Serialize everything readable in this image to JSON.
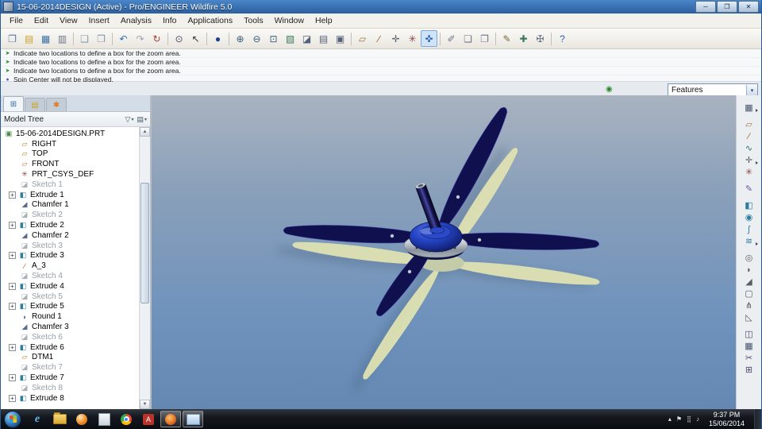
{
  "window": {
    "title": "15-06-2014DESIGN (Active) - Pro/ENGINEER Wildfire 5.0",
    "controls": [
      {
        "name": "minimize-button",
        "glyph": "─"
      },
      {
        "name": "maximize-button",
        "glyph": "❐"
      },
      {
        "name": "close-button",
        "glyph": "✕"
      }
    ]
  },
  "menu": [
    "File",
    "Edit",
    "View",
    "Insert",
    "Analysis",
    "Info",
    "Applications",
    "Tools",
    "Window",
    "Help"
  ],
  "toolbar": {
    "items": [
      {
        "name": "new-file-icon",
        "glyph": "❐",
        "color": "#5b7aa6"
      },
      {
        "name": "open-file-icon",
        "glyph": "▤",
        "color": "#c9a227"
      },
      {
        "name": "save-icon",
        "glyph": "▦",
        "color": "#3a6ea5"
      },
      {
        "name": "print-icon",
        "glyph": "▥",
        "color": "#6a7686"
      },
      {
        "sep": true
      },
      {
        "name": "copy-icon",
        "glyph": "❑",
        "color": "#8a96a6"
      },
      {
        "name": "paste-icon",
        "glyph": "❒",
        "color": "#8a96a6"
      },
      {
        "sep": true
      },
      {
        "name": "undo-icon",
        "glyph": "↶",
        "color": "#2f6fae"
      },
      {
        "name": "redo-icon",
        "glyph": "↷",
        "color": "#9aa6b4"
      },
      {
        "name": "regenerate-icon",
        "glyph": "↻",
        "color": "#b03a3a"
      },
      {
        "sep": true
      },
      {
        "name": "search-icon",
        "glyph": "⊙",
        "color": "#44506a"
      },
      {
        "name": "select-arrow-icon",
        "glyph": "↖",
        "color": "#333333"
      },
      {
        "sep": true
      },
      {
        "name": "shaded-display-icon",
        "glyph": "●",
        "color": "#1f3f8f"
      },
      {
        "sep": true
      },
      {
        "name": "zoom-in-icon",
        "glyph": "⊕",
        "color": "#3a5a7a"
      },
      {
        "name": "zoom-out-icon",
        "glyph": "⊖",
        "color": "#3a5a7a"
      },
      {
        "name": "refit-icon",
        "glyph": "⊡",
        "color": "#3a5a7a"
      },
      {
        "name": "repaint-icon",
        "glyph": "▧",
        "color": "#3a7a5a"
      },
      {
        "name": "saved-views-icon",
        "glyph": "◪",
        "color": "#55607a"
      },
      {
        "name": "layers-icon",
        "glyph": "▤",
        "color": "#55607a"
      },
      {
        "name": "view-manager-icon",
        "glyph": "▣",
        "color": "#55607a"
      },
      {
        "sep": true
      },
      {
        "name": "datum-planes-toggle",
        "glyph": "▱",
        "color": "#a07840"
      },
      {
        "name": "datum-axes-toggle",
        "glyph": "∕",
        "color": "#8b5a2b"
      },
      {
        "name": "datum-points-toggle",
        "glyph": "✛",
        "color": "#556066"
      },
      {
        "name": "csys-display-toggle",
        "glyph": "✳",
        "color": "#8b4444"
      },
      {
        "name": "spin-center-toggle",
        "glyph": "✜",
        "color": "#2f5faf",
        "pressed": true
      },
      {
        "sep": true
      },
      {
        "name": "annotation-icon",
        "glyph": "✐",
        "color": "#6a7686"
      },
      {
        "name": "model-windows-icon",
        "glyph": "❏",
        "color": "#6a7686"
      },
      {
        "name": "activate-window-icon",
        "glyph": "❐",
        "color": "#6a7686"
      },
      {
        "sep": true
      },
      {
        "name": "sketcher-display-icon",
        "glyph": "✎",
        "color": "#7a6a3a"
      },
      {
        "name": "analysis-measure-icon",
        "glyph": "✚",
        "color": "#3a7a5a"
      },
      {
        "name": "utilities-icon",
        "glyph": "✠",
        "color": "#6a7686"
      },
      {
        "sep": true
      },
      {
        "name": "context-help-icon",
        "glyph": "?",
        "color": "#2f5faf"
      }
    ]
  },
  "messages": [
    {
      "icon": "prompt-arrow-icon",
      "glyph": "➤",
      "color": "#1e8a1e",
      "text": "Indicate two locations to define a box for the zoom area."
    },
    {
      "icon": "prompt-arrow-icon",
      "glyph": "➤",
      "color": "#1e8a1e",
      "text": "Indicate two locations to define a box for the zoom area."
    },
    {
      "icon": "prompt-arrow-icon",
      "glyph": "➤",
      "color": "#1e8a1e",
      "text": "Indicate two locations to define a box for the zoom area."
    },
    {
      "icon": "info-dot-icon",
      "glyph": "●",
      "color": "#5a5ad6",
      "text": "Spin Center will not be displayed."
    }
  ],
  "subbar": {
    "status_icon": {
      "glyph": "◉",
      "color": "#2a8a2a"
    },
    "features_dropdown": {
      "value": "Features"
    }
  },
  "panel": {
    "tabs": [
      {
        "name": "tab-model-tree",
        "glyph": "⊞",
        "color": "#3a6ea5"
      },
      {
        "name": "tab-folder-browser",
        "glyph": "▤",
        "color": "#c9a227"
      },
      {
        "name": "tab-favorites",
        "glyph": "✱",
        "color": "#e07b20"
      }
    ],
    "header": {
      "title": "Model Tree"
    },
    "header_buttons": [
      {
        "name": "tree-filter-button",
        "glyph": "▽"
      },
      {
        "name": "tree-settings-button",
        "glyph": "▤"
      }
    ]
  },
  "model_tree": {
    "icon_defs": {
      "part": {
        "glyph": "▣",
        "color": "#4a8a4a"
      },
      "plane": {
        "glyph": "▱",
        "color": "#b08030"
      },
      "csys": {
        "glyph": "✳",
        "color": "#8b4444"
      },
      "sketch": {
        "glyph": "◪",
        "color": "#98a0a8"
      },
      "extrude": {
        "glyph": "◧",
        "color": "#2e7d9e"
      },
      "chamfer": {
        "glyph": "◢",
        "color": "#5a6a8a"
      },
      "round": {
        "glyph": "◗",
        "color": "#5a6a8a"
      },
      "axis": {
        "glyph": "∕",
        "color": "#8b5a2b"
      }
    },
    "items": [
      {
        "label": "15-06-2014DESIGN.PRT",
        "icon": "part",
        "root": true
      },
      {
        "label": "RIGHT",
        "icon": "plane"
      },
      {
        "label": "TOP",
        "icon": "plane"
      },
      {
        "label": "FRONT",
        "icon": "plane"
      },
      {
        "label": "PRT_CSYS_DEF",
        "icon": "csys"
      },
      {
        "label": "Sketch 1",
        "icon": "sketch",
        "disabled": true
      },
      {
        "label": "Extrude 1",
        "icon": "extrude",
        "expand": true
      },
      {
        "label": "Chamfer 1",
        "icon": "chamfer"
      },
      {
        "label": "Sketch 2",
        "icon": "sketch",
        "disabled": true
      },
      {
        "label": "Extrude 2",
        "icon": "extrude",
        "expand": true
      },
      {
        "label": "Chamfer 2",
        "icon": "chamfer"
      },
      {
        "label": "Sketch 3",
        "icon": "sketch",
        "disabled": true
      },
      {
        "label": "Extrude 3",
        "icon": "extrude",
        "expand": true
      },
      {
        "label": "A_3",
        "icon": "axis"
      },
      {
        "label": "Sketch 4",
        "icon": "sketch",
        "disabled": true
      },
      {
        "label": "Extrude 4",
        "icon": "extrude",
        "expand": true
      },
      {
        "label": "Sketch 5",
        "icon": "sketch",
        "disabled": true
      },
      {
        "label": "Extrude 5",
        "icon": "extrude",
        "expand": true
      },
      {
        "label": "Round 1",
        "icon": "round"
      },
      {
        "label": "Chamfer 3",
        "icon": "chamfer"
      },
      {
        "label": "Sketch 6",
        "icon": "sketch",
        "disabled": true
      },
      {
        "label": "Extrude 6",
        "icon": "extrude",
        "expand": true
      },
      {
        "label": "DTM1",
        "icon": "plane"
      },
      {
        "label": "Sketch 7",
        "icon": "sketch",
        "disabled": true
      },
      {
        "label": "Extrude 7",
        "icon": "extrude",
        "expand": true
      },
      {
        "label": "Sketch 8",
        "icon": "sketch",
        "disabled": true
      },
      {
        "label": "Extrude 8",
        "icon": "extrude",
        "expand": true
      }
    ]
  },
  "viewport": {
    "model": {
      "blade_color": "#10104e",
      "hub_color": "#2a4ac8",
      "shadow_color": "#dfe2b2",
      "ring_color": "#b8bfca"
    }
  },
  "right_toolbar": {
    "items": [
      {
        "name": "saved-view-list-icon",
        "glyph": "▦",
        "color": "#44506a",
        "flyout": true
      },
      {
        "gap": true
      },
      {
        "name": "datum-plane-tool",
        "glyph": "▱",
        "color": "#a07840"
      },
      {
        "name": "datum-axis-tool",
        "glyph": "∕",
        "color": "#8b5a2b"
      },
      {
        "name": "datum-curve-tool",
        "glyph": "∿",
        "color": "#2f6f6f"
      },
      {
        "name": "datum-point-tool",
        "glyph": "✛",
        "color": "#556066",
        "flyout": true
      },
      {
        "name": "datum-csys-tool",
        "glyph": "✳",
        "color": "#8b4444"
      },
      {
        "gap": true
      },
      {
        "name": "sketch-tool",
        "glyph": "✎",
        "color": "#6a5a9e"
      },
      {
        "gap": true
      },
      {
        "name": "extrude-tool",
        "glyph": "◧",
        "color": "#2e7d9e"
      },
      {
        "name": "revolve-tool",
        "glyph": "◉",
        "color": "#2e7d9e"
      },
      {
        "name": "sweep-tool",
        "glyph": "∫",
        "color": "#2e7d9e"
      },
      {
        "name": "blend-tool",
        "glyph": "≋",
        "color": "#2e7d9e",
        "flyout": true
      },
      {
        "gap": true
      },
      {
        "name": "hole-tool",
        "glyph": "◎",
        "color": "#556066"
      },
      {
        "name": "round-tool",
        "glyph": "◗",
        "color": "#556066"
      },
      {
        "name": "chamfer-tool",
        "glyph": "◢",
        "color": "#556066"
      },
      {
        "name": "shell-tool",
        "glyph": "▢",
        "color": "#556066"
      },
      {
        "name": "rib-tool",
        "glyph": "⋔",
        "color": "#556066"
      },
      {
        "name": "draft-tool",
        "glyph": "◺",
        "color": "#556066"
      },
      {
        "gap": true
      },
      {
        "name": "mirror-tool",
        "glyph": "◫",
        "color": "#44506a"
      },
      {
        "name": "pattern-tool",
        "glyph": "▦",
        "color": "#44506a"
      },
      {
        "name": "trim-tool",
        "glyph": "✂",
        "color": "#44506a"
      },
      {
        "name": "merge-tool",
        "glyph": "⊞",
        "color": "#44506a"
      }
    ]
  },
  "taskbar": {
    "buttons": [
      {
        "name": "taskbar-internet-explorer",
        "style": "ie",
        "glyph": "e",
        "active": false
      },
      {
        "name": "taskbar-windows-explorer",
        "style": "folder",
        "active": false
      },
      {
        "name": "taskbar-firefox",
        "style": "ball-orange",
        "active": false
      },
      {
        "name": "taskbar-calculator",
        "style": "calc",
        "active": false
      },
      {
        "name": "taskbar-chrome",
        "style": "chrome",
        "active": false
      },
      {
        "name": "taskbar-adobe-reader",
        "style": "adobe",
        "glyph": "A",
        "active": false
      },
      {
        "name": "taskbar-proe",
        "style": "proe",
        "active": true
      },
      {
        "name": "taskbar-proe-window",
        "style": "window",
        "active": true
      }
    ],
    "tray_icons": [
      {
        "name": "hidden-icons-button",
        "glyph": "▴"
      },
      {
        "name": "action-center-icon",
        "glyph": "⚑"
      },
      {
        "name": "network-icon",
        "glyph": "⣿"
      },
      {
        "name": "volume-icon",
        "glyph": "♪"
      }
    ],
    "clock": {
      "time": "9:37 PM",
      "date": "15/06/2014"
    }
  },
  "ui": {
    "combo_arrow": "▾",
    "scroll_up": "▲",
    "scroll_down": "▼",
    "expander": "+"
  }
}
